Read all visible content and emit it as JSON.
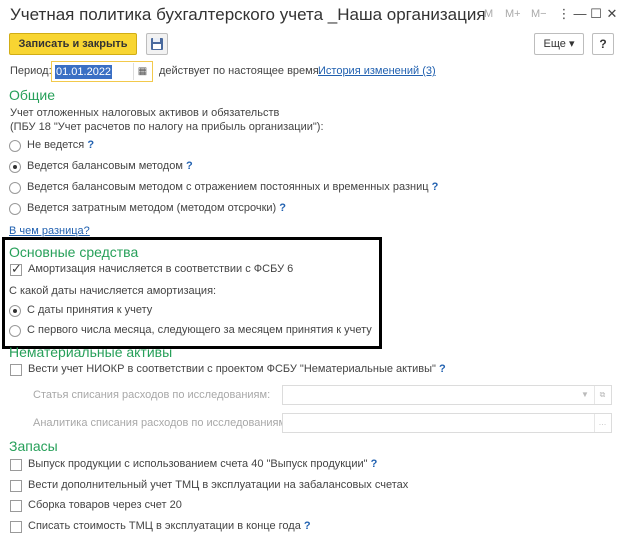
{
  "window": {
    "title": "Учетная политика бухгалтерского учета _Наша организация",
    "m_label": "M",
    "mplus_label": "M+",
    "mminus_label": "M−",
    "menu_glyph": "⋮",
    "minimize_glyph": "—",
    "maximize_glyph": "☐",
    "close_glyph": "✕"
  },
  "toolbar": {
    "save_close_label": "Записать и закрыть",
    "save_icon": "floppy-disk-icon",
    "more_label": "Еще ▾",
    "help_label": "?"
  },
  "period": {
    "label": "Период:",
    "value": "01.01.2022",
    "calendar_glyph": "▦",
    "note": "действует по настоящее время.",
    "history_link": "История изменений (3)"
  },
  "general": {
    "heading": "Общие",
    "description_line1": "Учет отложенных налоговых активов и обязательств",
    "description_line2": "(ПБУ 18 \"Учет расчетов по налогу на прибыль организации\"):",
    "options": [
      {
        "label": "Не ведется",
        "selected": false,
        "help": "?"
      },
      {
        "label": "Ведется балансовым методом",
        "selected": true,
        "help": "?"
      },
      {
        "label": "Ведется балансовым методом с отражением постоянных и временных разниц",
        "selected": false,
        "help": "?"
      },
      {
        "label": "Ведется затратным методом (методом отсрочки)",
        "selected": false,
        "help": "?"
      }
    ],
    "diff_link": "В чем разница?"
  },
  "fixed_assets": {
    "heading": "Основные средства",
    "amortization_checkbox": "Амортизация начисляется в соответствии с ФСБУ 6",
    "amortization_checked": true,
    "start_label": "С какой даты начисляется амортизация:",
    "options": [
      {
        "label": "С даты принятия к учету",
        "selected": true
      },
      {
        "label": "С первого числа месяца, следующего за месяцем принятия к учету",
        "selected": false
      }
    ]
  },
  "intangible": {
    "heading": "Нематериальные активы",
    "niokr_checkbox": "Вести учет НИОКР в соответствии с проектом ФСБУ \"Нематериальные активы\"",
    "niokr_checked": false,
    "help": "?",
    "research_writeoff_label": "Статья списания расходов по исследованиям:",
    "research_analytics_label": "Аналитика списания расходов по исследованиям:"
  },
  "inventory": {
    "heading": "Запасы",
    "items": [
      {
        "label": "Выпуск продукции с использованием счета 40 \"Выпуск продукции\"",
        "checked": false,
        "help": "?"
      },
      {
        "label": "Вести дополнительный учет ТМЦ в эксплуатации на забалансовых счетах",
        "checked": false,
        "help": ""
      },
      {
        "label": "Сборка товаров через счет 20",
        "checked": false,
        "help": ""
      },
      {
        "label": "Списать стоимость ТМЦ в эксплуатации в конце года",
        "checked": false,
        "help": "?"
      }
    ]
  }
}
